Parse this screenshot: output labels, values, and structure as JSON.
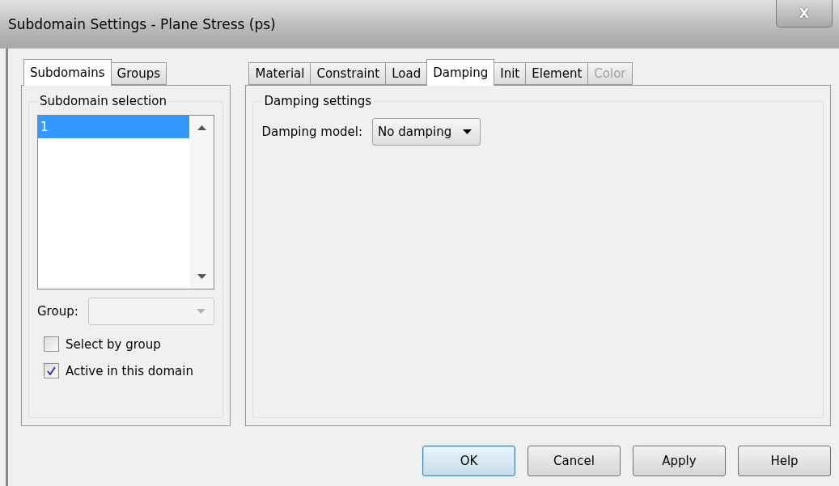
{
  "window": {
    "title": "Subdomain Settings - Plane Stress (ps)",
    "close": "X"
  },
  "left_tabs": [
    {
      "label": "Subdomains",
      "selected": true
    },
    {
      "label": "Groups",
      "selected": false
    }
  ],
  "subdomain_selection": {
    "title": "Subdomain selection",
    "items": [
      {
        "label": "1",
        "selected": true
      }
    ],
    "group": {
      "label": "Group:",
      "disabled": true
    },
    "checkboxes": [
      {
        "label": "Select by group",
        "checked": false
      },
      {
        "label": "Active in this domain",
        "checked": true
      }
    ]
  },
  "right_tabs": [
    {
      "label": "Material",
      "selected": false,
      "disabled": false
    },
    {
      "label": "Constraint",
      "selected": false,
      "disabled": false
    },
    {
      "label": "Load",
      "selected": false,
      "disabled": false
    },
    {
      "label": "Damping",
      "selected": true,
      "disabled": false
    },
    {
      "label": "Init",
      "selected": false,
      "disabled": false
    },
    {
      "label": "Element",
      "selected": false,
      "disabled": false
    },
    {
      "label": "Color",
      "selected": false,
      "disabled": true
    }
  ],
  "damping_settings": {
    "title": "Damping settings",
    "model_label": "Damping model:",
    "model_value": "No damping"
  },
  "buttons": [
    {
      "label": "OK",
      "default": true
    },
    {
      "label": "Cancel",
      "default": false
    },
    {
      "label": "Apply",
      "default": false
    },
    {
      "label": "Help",
      "default": false
    }
  ]
}
